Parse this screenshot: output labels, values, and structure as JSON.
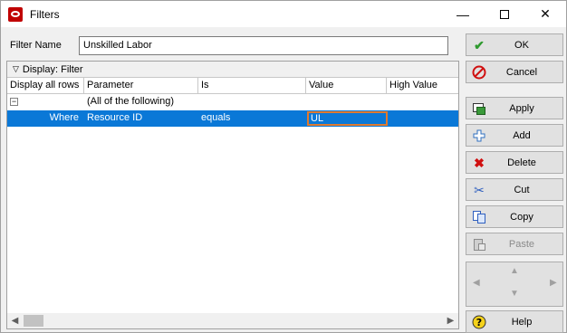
{
  "window": {
    "title": "Filters",
    "minimize_glyph": "—",
    "close_glyph": "✕"
  },
  "filter_name": {
    "label": "Filter Name",
    "value": "Unskilled Labor"
  },
  "grid": {
    "group_label": "Display: Filter",
    "columns": [
      "Display all rows",
      "Parameter",
      "Is",
      "Value",
      "High Value"
    ],
    "rows": [
      {
        "expand": "−",
        "display": "",
        "parameter": "(All of the following)",
        "is": "",
        "value": "",
        "high": ""
      },
      {
        "expand": "",
        "display": "Where",
        "parameter": "Resource ID",
        "is": "equals",
        "value": "UL",
        "high": ""
      }
    ]
  },
  "buttons": {
    "ok": "OK",
    "cancel": "Cancel",
    "apply": "Apply",
    "add": "Add",
    "delete": "Delete",
    "cut": "Cut",
    "copy": "Copy",
    "paste": "Paste",
    "help": "Help"
  },
  "icons": {
    "ok": "check-icon",
    "cancel": "no-entry-icon",
    "apply": "apply-icon",
    "add": "plus-icon",
    "delete": "x-icon",
    "cut": "scissors-icon",
    "copy": "copy-icon",
    "paste": "paste-icon",
    "help": "help-icon"
  },
  "colors": {
    "selection": "#0a78d7",
    "edit_border": "#e07a2e",
    "brand": "#c00000"
  }
}
